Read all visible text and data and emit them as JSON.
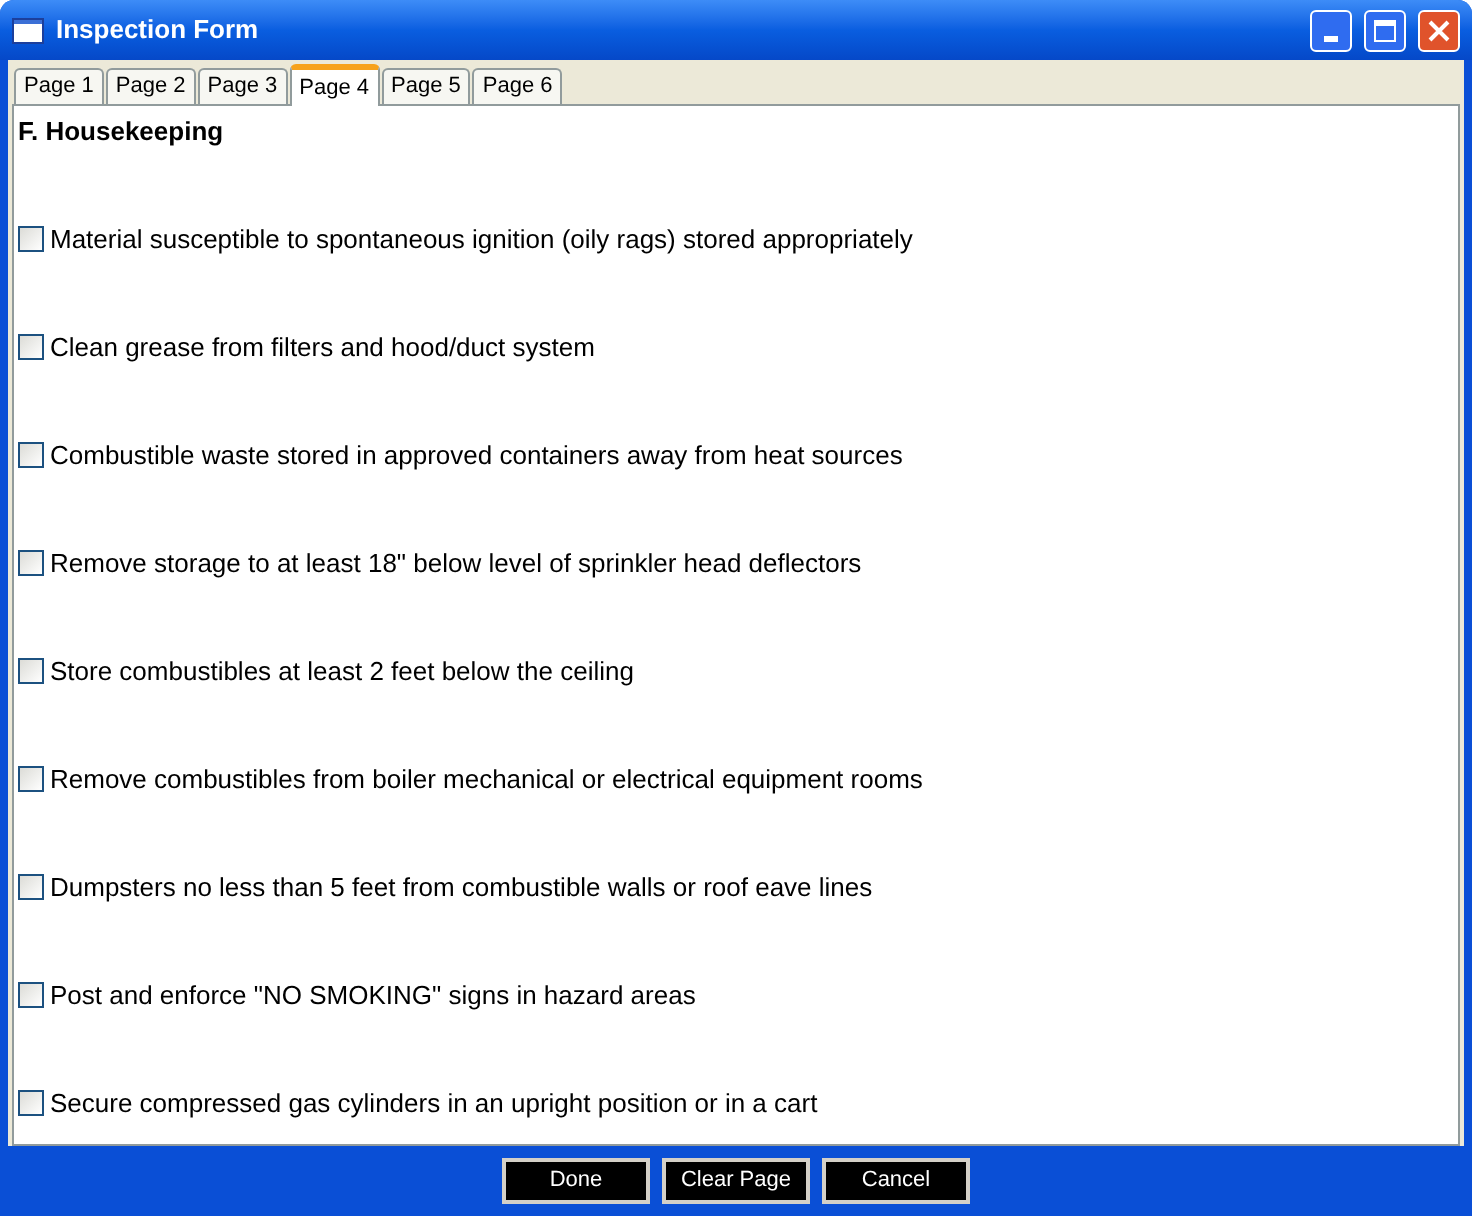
{
  "window": {
    "title": "Inspection Form"
  },
  "tabs": [
    {
      "label": "Page 1",
      "selected": false
    },
    {
      "label": "Page 2",
      "selected": false
    },
    {
      "label": "Page 3",
      "selected": false
    },
    {
      "label": "Page 4",
      "selected": true
    },
    {
      "label": "Page 5",
      "selected": false
    },
    {
      "label": "Page 6",
      "selected": false
    }
  ],
  "section": {
    "heading": "F. Housekeeping"
  },
  "items": [
    {
      "label": "Material susceptible to spontaneous ignition (oily rags) stored appropriately",
      "checked": false
    },
    {
      "label": "Clean grease from filters and hood/duct system",
      "checked": false
    },
    {
      "label": "Combustible waste stored in approved containers away from heat sources",
      "checked": false
    },
    {
      "label": "Remove storage to at least 18\" below level of sprinkler head deflectors",
      "checked": false
    },
    {
      "label": "Store combustibles at least 2 feet below the ceiling",
      "checked": false
    },
    {
      "label": "Remove combustibles from boiler mechanical or electrical equipment rooms",
      "checked": false
    },
    {
      "label": "Dumpsters no less than 5 feet from combustible walls or roof eave lines",
      "checked": false
    },
    {
      "label": "Post and enforce \"NO SMOKING\" signs in hazard areas",
      "checked": false
    },
    {
      "label": "Secure compressed gas cylinders in an upright position or in a cart",
      "checked": false
    }
  ],
  "buttons": [
    "Done",
    "Clear Page",
    "Cancel"
  ]
}
